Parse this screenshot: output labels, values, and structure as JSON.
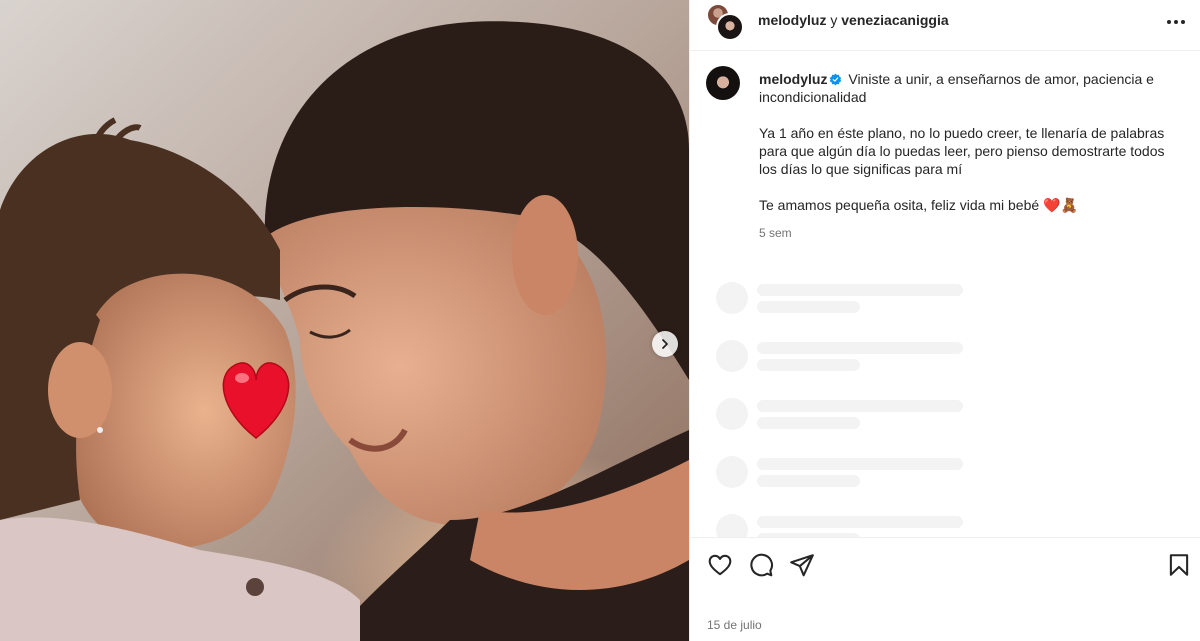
{
  "header": {
    "user1": "melodyluz",
    "conjunction": "y",
    "user2": "veneziacaniggia"
  },
  "caption": {
    "username": "melodyluz",
    "line1": "Viniste a unir, a enseñarnos de amor, paciencia e incondicionalidad",
    "line2": "Ya 1 año en éste plano, no lo puedo creer, te llenaría de palabras para que algún día lo puedas leer, pero pienso demostrarte todos los días lo que significas para mí",
    "line3": "Te amamos pequeña osita, feliz vida mi bebé ❤️🧸",
    "time": "5 sem"
  },
  "footer": {
    "date": "15 de julio"
  },
  "icons": {
    "like": "heart-icon",
    "comment": "comment-icon",
    "share": "share-icon",
    "save": "bookmark-icon",
    "more": "more-horizontal-icon",
    "next": "chevron-right-icon",
    "verified": "verified-badge-icon"
  },
  "colors": {
    "text": "#262626",
    "secondary": "#737373",
    "verified": "#0095f6",
    "skeleton": "#f3f3f3",
    "border": "#efefef"
  }
}
